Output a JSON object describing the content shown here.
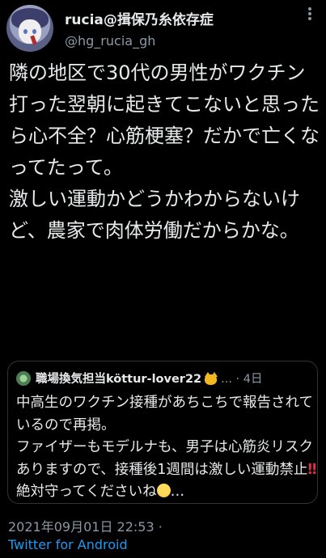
{
  "author": {
    "display_name": "rucia@揖保乃糸依存症",
    "handle": "@hg_rucia_gh",
    "avatar_icon": "anime-avatar-icon",
    "more_icon": "more-options-icon"
  },
  "tweet": {
    "text": "隣の地区で30代の男性がワクチン打った翌朝に起きてこないと思ったら心不全？心筋梗塞？だかで亡くなってたって。\n激しい運動かどうかわからないけど、農家で肉体労働だからかな。",
    "timestamp": "2021年09月01日 22:53 ·",
    "source": "Twitter for Android"
  },
  "quoted_tweet": {
    "display_name": "職場換気担当köttur-lover22",
    "meta": "... · 4日",
    "text_before": "中高生のワクチン接種があちこちで報告されているので再掲。\nファイザーもモデルナも、男子は心筋炎リスクありますので、接種後1週間は激しい運動禁止",
    "bang": "‼",
    "text_after": "絶対守ってくださいね",
    "ellipsis": "…",
    "avatar_icon": "plant-avatar-icon",
    "cat_icon": "cat-face-emoji-icon",
    "face_icon": "smiling-face-emoji-icon"
  },
  "colors": {
    "background": "#000000",
    "text": "#e7e9ea",
    "secondary": "#8b98a5",
    "link": "#1d9bf0",
    "border": "#2f3336"
  }
}
